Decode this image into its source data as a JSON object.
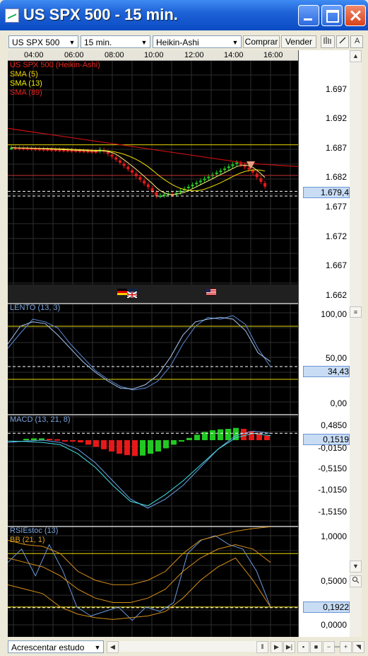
{
  "window": {
    "title": "US SPX 500 - 15 min."
  },
  "toolbar": {
    "symbol": "US SPX 500",
    "interval": "15 min.",
    "chart_type": "Heikin-Ashi",
    "buy_label": "Comprar",
    "sell_label": "Vender"
  },
  "x_ticks": [
    "04:00",
    "06:00",
    "08:00",
    "10:00",
    "12:00",
    "14:00",
    "16:00"
  ],
  "panels": {
    "price": {
      "legend": [
        {
          "text": "US SPX 500 (Heikin-Ashi)",
          "color": "#e8261d"
        },
        {
          "text": "SMA (5)",
          "color": "#f0d000"
        },
        {
          "text": "SMA (13)",
          "color": "#f0f000"
        },
        {
          "text": "SMA (89)",
          "color": "#e8261d"
        }
      ],
      "y_labels": [
        "1.697",
        "1.692",
        "1.687",
        "1.682",
        "1.677",
        "1.672",
        "1.667",
        "1.662"
      ],
      "current": "1.679,4"
    },
    "lento": {
      "legend": "LENTO (13, 3)",
      "y_labels": [
        "100,00",
        "50,00",
        "0,00"
      ],
      "current": "34,43"
    },
    "macd": {
      "legend": "MACD (13, 21, 8)",
      "y_labels": [
        "0,4850",
        "-0,0150",
        "-0,5150",
        "-1,0150",
        "-1,5150"
      ],
      "current": "0,1519"
    },
    "rsi": {
      "legend": "RSIEstoc (13)",
      "legend2": "BB (21, 1)",
      "y_labels": [
        "1,0000",
        "0,5000",
        "0,0000"
      ],
      "current": "0,1922"
    }
  },
  "bottom": {
    "add_study_label": "Acrescentar estudo"
  },
  "colors": {
    "bull": "#22c822",
    "bear": "#e81818",
    "sma5": "#f0e000",
    "sma89": "#c81010",
    "grid": "#2e2e2e"
  },
  "chart_data": {
    "type": "line",
    "x": [
      "04:00",
      "06:00",
      "08:00",
      "10:00",
      "12:00",
      "14:00",
      "16:00"
    ],
    "series": [
      {
        "name": "US SPX 500 (Heikin-Ashi)",
        "values": [
          1.6868,
          1.6866,
          1.6865,
          1.6788,
          1.6788,
          1.6825,
          1.6794
        ]
      },
      {
        "name": "SMA (89)",
        "values": [
          1.6901,
          1.6891,
          1.6877,
          1.6864,
          1.6851,
          1.6839,
          1.6834
        ]
      },
      {
        "name": "LENTO (13, 3)",
        "values": [
          55,
          88,
          60,
          15,
          25,
          82,
          34.43
        ]
      },
      {
        "name": "MACD (13, 21, 8)",
        "values": [
          -0.01,
          -0.05,
          -0.1,
          -0.8,
          -1.5,
          -0.3,
          0.1519
        ]
      },
      {
        "name": "RSIEstoc (13)",
        "values": [
          0.7,
          0.85,
          0.15,
          0.2,
          0.95,
          0.85,
          0.1922
        ]
      }
    ],
    "ylim": [
      1.662,
      1.701
    ]
  }
}
